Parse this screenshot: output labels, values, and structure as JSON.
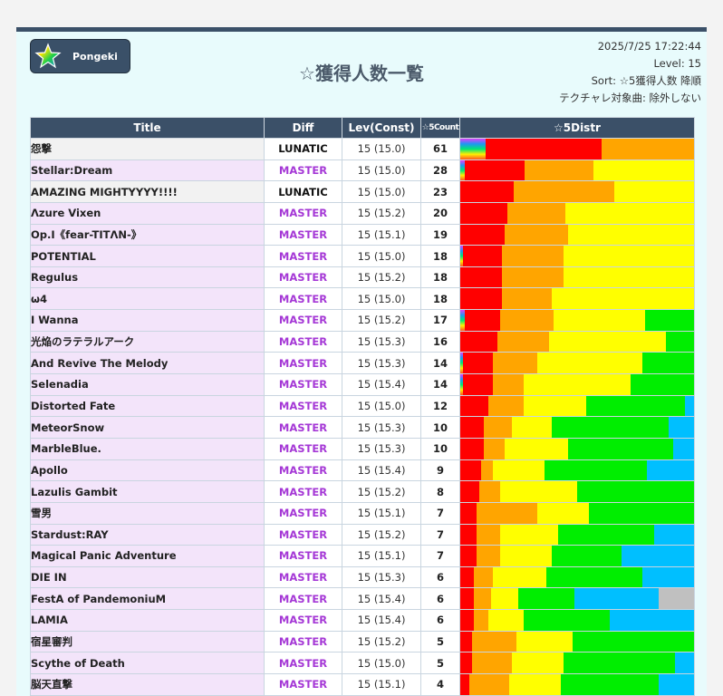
{
  "logo": {
    "name": "Pongeki"
  },
  "page_title": "☆獲得人数一覧",
  "info": {
    "datetime": "2025/7/25 17:22:44",
    "level": "Level: 15",
    "sort": "Sort: ☆5獲得人数 降順",
    "filter": "テクチャレ対象曲: 除外しない"
  },
  "columns": [
    "Title",
    "Diff",
    "Lev(Const)",
    "☆5Count",
    "☆5Distr"
  ],
  "distr_colors": [
    "rainbow",
    "#ff0000",
    "#ffa500",
    "#ffff00",
    "#00ee00",
    "#00bfff",
    "#c0c0c0"
  ],
  "rows": [
    {
      "title": "怨撃",
      "diff": "LUNATIC",
      "lev": "15 (15.0)",
      "count": "61",
      "distr": [
        11,
        50,
        40,
        0,
        0,
        0,
        0
      ]
    },
    {
      "title": "Stellar:Dream",
      "diff": "MASTER",
      "lev": "15 (15.0)",
      "count": "28",
      "distr": [
        2,
        26,
        30,
        44,
        0,
        0,
        0
      ]
    },
    {
      "title": "AMAZING MIGHTYYYY!!!!",
      "diff": "LUNATIC",
      "lev": "15 (15.0)",
      "count": "23",
      "distr": [
        0,
        23,
        43,
        34,
        0,
        0,
        0
      ]
    },
    {
      "title": "Λzure Vixen",
      "diff": "MASTER",
      "lev": "15 (15.2)",
      "count": "20",
      "distr": [
        0,
        20,
        25,
        55,
        0,
        0,
        0
      ]
    },
    {
      "title": "Op.I《fear-TITΛN-》",
      "diff": "MASTER",
      "lev": "15 (15.1)",
      "count": "19",
      "distr": [
        0,
        19,
        27,
        54,
        0,
        0,
        0
      ]
    },
    {
      "title": "POTENTIAL",
      "diff": "MASTER",
      "lev": "15 (15.0)",
      "count": "18",
      "distr": [
        1,
        17,
        26,
        56,
        0,
        0,
        0
      ]
    },
    {
      "title": "Regulus",
      "diff": "MASTER",
      "lev": "15 (15.2)",
      "count": "18",
      "distr": [
        0,
        18,
        26,
        56,
        0,
        0,
        0
      ]
    },
    {
      "title": "ω4",
      "diff": "MASTER",
      "lev": "15 (15.0)",
      "count": "18",
      "distr": [
        0,
        18,
        21,
        61,
        0,
        0,
        0
      ]
    },
    {
      "title": "I Wanna",
      "diff": "MASTER",
      "lev": "15 (15.2)",
      "count": "17",
      "distr": [
        2,
        15,
        23,
        39,
        21,
        0,
        0
      ]
    },
    {
      "title": "光焔のラテラルアーク",
      "diff": "MASTER",
      "lev": "15 (15.3)",
      "count": "16",
      "distr": [
        0,
        16,
        22,
        50,
        12,
        0,
        0
      ]
    },
    {
      "title": "And Revive The Melody",
      "diff": "MASTER",
      "lev": "15 (15.3)",
      "count": "14",
      "distr": [
        1,
        13,
        19,
        45,
        22,
        0,
        0
      ]
    },
    {
      "title": "Selenadia",
      "diff": "MASTER",
      "lev": "15 (15.4)",
      "count": "14",
      "distr": [
        1,
        13,
        13,
        46,
        27,
        0,
        0
      ]
    },
    {
      "title": "Distorted Fate",
      "diff": "MASTER",
      "lev": "15 (15.0)",
      "count": "12",
      "distr": [
        0,
        12,
        15,
        27,
        42,
        4,
        0
      ]
    },
    {
      "title": "MeteorSnow",
      "diff": "MASTER",
      "lev": "15 (15.3)",
      "count": "10",
      "distr": [
        0,
        10,
        12,
        17,
        50,
        11,
        0
      ]
    },
    {
      "title": "MarbleBlue.",
      "diff": "MASTER",
      "lev": "15 (15.3)",
      "count": "10",
      "distr": [
        0,
        10,
        9,
        27,
        45,
        9,
        0
      ]
    },
    {
      "title": "Apollo",
      "diff": "MASTER",
      "lev": "15 (15.4)",
      "count": "9",
      "distr": [
        0,
        9,
        5,
        22,
        44,
        20,
        0
      ]
    },
    {
      "title": "Lazulis Gambit",
      "diff": "MASTER",
      "lev": "15 (15.2)",
      "count": "8",
      "distr": [
        0,
        8,
        9,
        33,
        50,
        0,
        0
      ]
    },
    {
      "title": "雪男",
      "diff": "MASTER",
      "lev": "15 (15.1)",
      "count": "7",
      "distr": [
        0,
        7,
        26,
        22,
        45,
        0,
        0
      ]
    },
    {
      "title": "Stardust:RAY",
      "diff": "MASTER",
      "lev": "15 (15.2)",
      "count": "7",
      "distr": [
        0,
        7,
        10,
        25,
        41,
        17,
        0
      ]
    },
    {
      "title": "Magical Panic Adventure",
      "diff": "MASTER",
      "lev": "15 (15.1)",
      "count": "7",
      "distr": [
        0,
        7,
        10,
        22,
        30,
        31,
        0
      ]
    },
    {
      "title": "DIE IN",
      "diff": "MASTER",
      "lev": "15 (15.3)",
      "count": "6",
      "distr": [
        0,
        6,
        8,
        23,
        41,
        22,
        0
      ]
    },
    {
      "title": "FestA of PandemoniuM",
      "diff": "MASTER",
      "lev": "15 (15.4)",
      "count": "6",
      "distr": [
        0,
        6,
        7,
        12,
        24,
        36,
        15
      ]
    },
    {
      "title": "LAMIA",
      "diff": "MASTER",
      "lev": "15 (15.4)",
      "count": "6",
      "distr": [
        0,
        6,
        6,
        15,
        37,
        36,
        0
      ]
    },
    {
      "title": "宿星審判",
      "diff": "MASTER",
      "lev": "15 (15.2)",
      "count": "5",
      "distr": [
        0,
        5,
        19,
        24,
        52,
        0,
        0
      ]
    },
    {
      "title": "Scythe of Death",
      "diff": "MASTER",
      "lev": "15 (15.0)",
      "count": "5",
      "distr": [
        0,
        5,
        17,
        22,
        48,
        8,
        0
      ]
    },
    {
      "title": "脳天直撃",
      "diff": "MASTER",
      "lev": "15 (15.1)",
      "count": "4",
      "distr": [
        0,
        4,
        17,
        22,
        42,
        15,
        0
      ]
    }
  ]
}
